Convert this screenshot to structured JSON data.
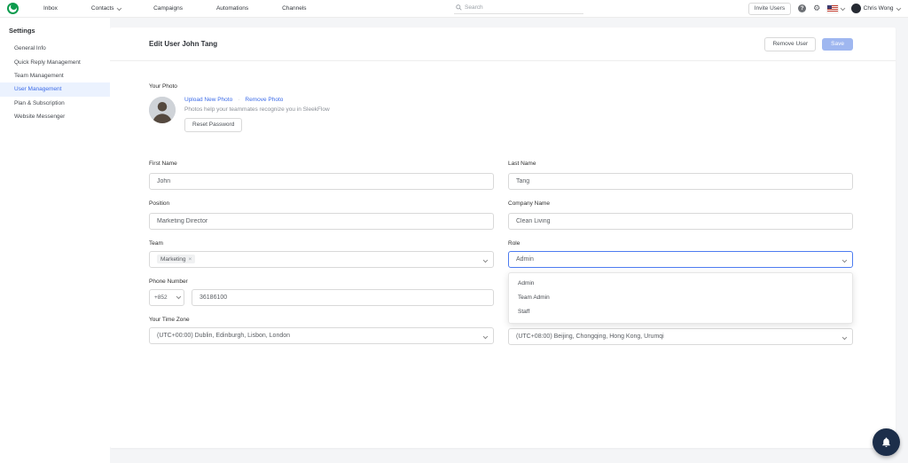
{
  "navbar": {
    "items": [
      "Inbox",
      "Contacts",
      "Campaigns",
      "Automations",
      "Channels"
    ],
    "search": {
      "placeholder": "Search"
    },
    "invite_users_label": "Invite Users",
    "user": {
      "name": "Chris Wong"
    }
  },
  "sidebar": {
    "title": "Settings",
    "items": [
      "General Info",
      "Quick Reply Management",
      "Team Management",
      "User Management",
      "Plan & Subscription",
      "Website Messenger"
    ],
    "active_item": "User Management"
  },
  "page": {
    "title": "Edit User John Tang",
    "remove_user_label": "Remove User",
    "save_label": "Save"
  },
  "photo": {
    "section_label": "Your Photo",
    "upload_label": "Upload New Photo",
    "separator": "·",
    "remove_label": "Remove Photo",
    "hint": "Photos help your teammates recognize you in SleekFlow",
    "reset_password_label": "Reset Password"
  },
  "form": {
    "first_name": {
      "label": "First Name",
      "value": "John"
    },
    "last_name": {
      "label": "Last Name",
      "value": "Tang"
    },
    "position": {
      "label": "Position",
      "value": "Marketing Director"
    },
    "company_name": {
      "label": "Company Name",
      "value": "Clean Living"
    },
    "team": {
      "label": "Team",
      "value": "Marketing"
    },
    "role": {
      "label": "Role",
      "value": "Admin",
      "options": [
        "Admin",
        "Team Admin",
        "Staff"
      ]
    },
    "phone": {
      "label": "Phone Number",
      "country_code": "+852",
      "value": "36186100"
    },
    "timezone": {
      "label": "Your Time Zone",
      "value": "(UTC+00:00) Dublin, Edinburgh, Lisbon, London"
    },
    "timezone_secondary": {
      "value": "(UTC+08:00) Beijing, Chongqing, Hong Kong, Urumqi"
    }
  },
  "icons": {
    "gear": "⚙",
    "help": "?",
    "close": "×"
  },
  "colors": {
    "accent": "#3b6be8",
    "save_disabled": "#9fb7f0",
    "logo_green": "#0c9b4d"
  }
}
